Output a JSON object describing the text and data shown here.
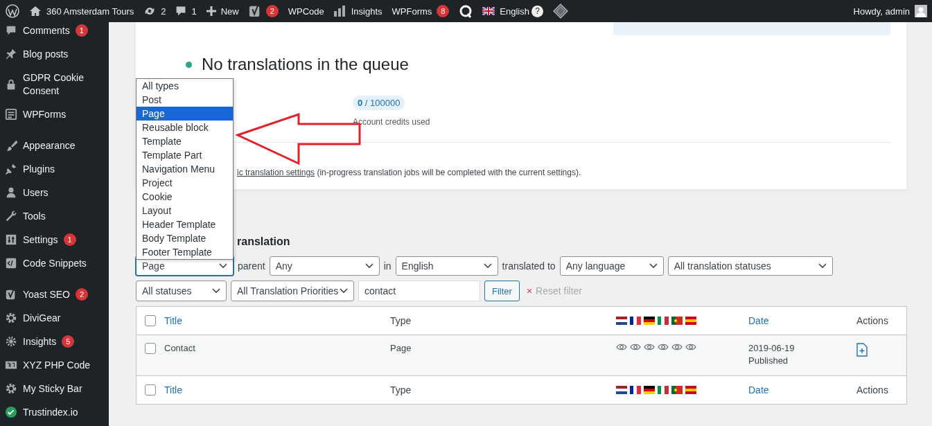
{
  "admin_bar": {
    "site": "360 Amsterdam Tours",
    "updates": "2",
    "comments": "1",
    "new": "New",
    "yoast_badge": "2",
    "wpcode": "WPCode",
    "insights": "Insights",
    "wpforms": "WPForms",
    "wpforms_badge": "8",
    "language": "English",
    "help": "?",
    "greeting": "Howdy, admin"
  },
  "sidebar": {
    "groups": [
      [
        {
          "label": "Comments",
          "badge": "1"
        },
        {
          "label": "Blog posts"
        },
        {
          "label": "GDPR Cookie Consent"
        },
        {
          "label": "WPForms"
        }
      ],
      [
        {
          "label": "Appearance"
        },
        {
          "label": "Plugins"
        },
        {
          "label": "Users"
        },
        {
          "label": "Tools"
        },
        {
          "label": "Settings",
          "badge": "1"
        },
        {
          "label": "Code Snippets"
        }
      ],
      [
        {
          "label": "Yoast SEO",
          "badge": "2"
        },
        {
          "label": "DiviGear"
        },
        {
          "label": "Insights",
          "badge": "5"
        },
        {
          "label": "XYZ PHP Code"
        },
        {
          "label": "My Sticky Bar"
        },
        {
          "label": "Trustindex.io"
        }
      ]
    ]
  },
  "status_card": {
    "queue_message": "No translations in the queue",
    "credits": "**0** / 100000",
    "credits_label": "Account credits used",
    "note_link": "ic translation settings",
    "note_text": "(in-progress translation jobs will be completed with the current settings)."
  },
  "section_heading": "ranslation",
  "filters": {
    "row_1": [
      {
        "kind": "select",
        "value": "Page",
        "focused": true,
        "open": true,
        "options": [
          {
            "label": "All types",
            "selected": false
          },
          {
            "label": "Post",
            "selected": false
          },
          {
            "label": "Page",
            "selected": true
          },
          {
            "label": "Reusable block",
            "selected": false
          },
          {
            "label": "Template",
            "selected": false
          },
          {
            "label": "Template Part",
            "selected": false
          },
          {
            "label": "Navigation Menu",
            "selected": false
          },
          {
            "label": "Project",
            "selected": false
          },
          {
            "label": "Cookie",
            "selected": false
          },
          {
            "label": "Layout",
            "selected": false
          },
          {
            "label": "Header Template",
            "selected": false
          },
          {
            "label": "Body Template",
            "selected": false
          },
          {
            "label": "Footer Template",
            "selected": false
          }
        ]
      },
      {
        "kind": "label",
        "text": "parent"
      },
      {
        "kind": "select",
        "value": "Any",
        "focused": false
      },
      {
        "kind": "label",
        "text": "in"
      },
      {
        "kind": "select",
        "value": "English",
        "focused": false
      },
      {
        "kind": "label",
        "text": "translated to"
      },
      {
        "kind": "select",
        "value": "Any language",
        "focused": false
      },
      {
        "kind": "select",
        "value": "All translation statuses",
        "focused": false
      }
    ],
    "row_2": [
      {
        "kind": "select",
        "value": "All statuses",
        "focused": false
      },
      {
        "kind": "select",
        "value": "All Translation Priorities",
        "focused": false
      },
      {
        "kind": "search",
        "value": "contact"
      },
      {
        "kind": "button",
        "text": "Filter"
      },
      {
        "kind": "reset",
        "icon": "×",
        "text": "Reset filter"
      }
    ]
  },
  "table": {
    "header": {
      "checked": false,
      "title": "Title",
      "type": "Type",
      "date": "Date",
      "actions": "Actions"
    },
    "rows": [
      {
        "checked": false,
        "title": "Contact",
        "type": "Page",
        "date": "2019-06-19",
        "status": "Published"
      }
    ],
    "footer": {
      "checked": false,
      "title": "Title",
      "type": "Type",
      "date": "Date",
      "actions": "Actions"
    }
  }
}
